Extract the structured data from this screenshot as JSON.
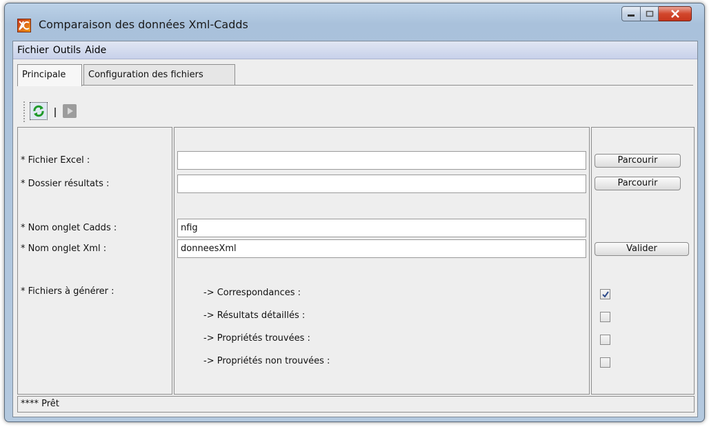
{
  "window": {
    "title": "Comparaison des données Xml-Cadds"
  },
  "menu": [
    "Fichier",
    "Outils",
    "Aide"
  ],
  "tabs": [
    {
      "label": "Principale",
      "active": true
    },
    {
      "label": "Configuration des fichiers",
      "active": false
    }
  ],
  "toolbar": {
    "refresh_icon": "refresh-icon",
    "separator": "|",
    "run_icon": "play-icon"
  },
  "form": {
    "excel_label": "* Fichier Excel :",
    "excel_value": "",
    "results_label": "* Dossier résultats :",
    "results_value": "",
    "cadds_tab_label": "* Nom onglet Cadds :",
    "cadds_tab_value": "nfig",
    "xml_tab_label": "* Nom onglet Xml :",
    "xml_tab_value": "donneesXml",
    "files_label": "* Fichiers à générer :",
    "browse_label": "Parcourir",
    "validate_label": "Valider",
    "outputs": [
      {
        "label": "-> Correspondances :",
        "checked": true
      },
      {
        "label": "-> Résultats détaillés :",
        "checked": false
      },
      {
        "label": "-> Propriétés trouvées :",
        "checked": false
      },
      {
        "label": "-> Propriétés non trouvées :",
        "checked": false
      }
    ]
  },
  "status": {
    "text": "**** Prêt"
  },
  "colors": {
    "accent": "#c7361d",
    "menubar": "#c8d1ea",
    "checkmark": "#2c4a8a"
  }
}
